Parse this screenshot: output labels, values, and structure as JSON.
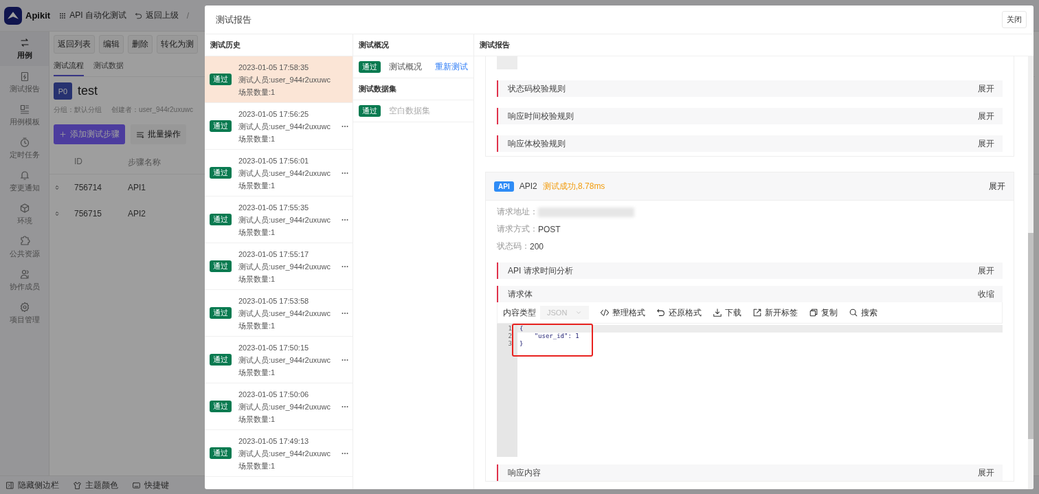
{
  "app": {
    "logo": "Apikit",
    "project": "API 自动化测试",
    "back": "返回上级",
    "separator": "/"
  },
  "sidebar": {
    "items": [
      {
        "label": "用例",
        "selected": true
      },
      {
        "label": "测试报告",
        "selected": false
      },
      {
        "label": "用例模板",
        "selected": false
      },
      {
        "label": "定时任务",
        "selected": false
      },
      {
        "label": "变更通知",
        "selected": false
      },
      {
        "label": "环境",
        "selected": false
      },
      {
        "label": "公共资源",
        "selected": false
      },
      {
        "label": "协作成员",
        "selected": false
      },
      {
        "label": "项目管理",
        "selected": false
      }
    ]
  },
  "toolbar": {
    "buttons": [
      "返回列表",
      "编辑",
      "删除",
      "转化为测"
    ]
  },
  "tabs": [
    {
      "label": "测试流程",
      "selected": true
    },
    {
      "label": "测试数据",
      "selected": false
    }
  ],
  "case": {
    "avatar": "P0",
    "name": "test",
    "group": "分组：默认分组",
    "creator": "创建者：user_944r2uxuwc"
  },
  "actions": {
    "add": "添加测试步骤",
    "batch": "批量操作"
  },
  "table": {
    "columns": [
      "ID",
      "步骤名称"
    ],
    "rows": [
      {
        "id": "756714",
        "name": "API1"
      },
      {
        "id": "756715",
        "name": "API2"
      }
    ]
  },
  "bottom_bar": [
    "隐藏侧边栏",
    "主题颜色",
    "快捷键"
  ],
  "modal": {
    "title": "测试报告",
    "close": "关闭",
    "history": {
      "title": "测试历史",
      "items": [
        {
          "status": "通过",
          "time": "2023-01-05 17:58:35",
          "tester": "测试人员:user_944r2uxuwc",
          "scenes": "场景数量:1",
          "selected": true
        },
        {
          "status": "通过",
          "time": "2023-01-05 17:56:25",
          "tester": "测试人员:user_944r2uxuwc",
          "scenes": "场景数量:1",
          "selected": false
        },
        {
          "status": "通过",
          "time": "2023-01-05 17:56:01",
          "tester": "测试人员:user_944r2uxuwc",
          "scenes": "场景数量:1",
          "selected": false
        },
        {
          "status": "通过",
          "time": "2023-01-05 17:55:35",
          "tester": "测试人员:user_944r2uxuwc",
          "scenes": "场景数量:1",
          "selected": false
        },
        {
          "status": "通过",
          "time": "2023-01-05 17:55:17",
          "tester": "测试人员:user_944r2uxuwc",
          "scenes": "场景数量:1",
          "selected": false
        },
        {
          "status": "通过",
          "time": "2023-01-05 17:53:58",
          "tester": "测试人员:user_944r2uxuwc",
          "scenes": "场景数量:1",
          "selected": false
        },
        {
          "status": "通过",
          "time": "2023-01-05 17:50:15",
          "tester": "测试人员:user_944r2uxuwc",
          "scenes": "场景数量:1",
          "selected": false
        },
        {
          "status": "通过",
          "time": "2023-01-05 17:50:06",
          "tester": "测试人员:user_944r2uxuwc",
          "scenes": "场景数量:1",
          "selected": false
        },
        {
          "status": "通过",
          "time": "2023-01-05 17:49:13",
          "tester": "测试人员:user_944r2uxuwc",
          "scenes": "场景数量:1",
          "selected": false
        }
      ]
    },
    "overview": {
      "title": "测试概况",
      "summary": {
        "status": "通过",
        "label": "测试概况",
        "action": "重新测试"
      },
      "dataset_title": "测试数据集",
      "datasets": [
        {
          "status": "通过",
          "label": "空白数据集"
        }
      ]
    },
    "report": {
      "title": "测试报告",
      "rules": [
        {
          "label": "状态码校验规则",
          "toggle": "展开"
        },
        {
          "label": "响应时间校验规则",
          "toggle": "展开"
        },
        {
          "label": "响应体校验规则",
          "toggle": "展开"
        }
      ],
      "api": {
        "badge": "API",
        "name": "API2",
        "result": "测试成功,8.78ms",
        "toggle": "展开",
        "fields": [
          {
            "kind": "blurred",
            "label": "请求地址："
          },
          {
            "kind": "text",
            "label": "请求方式：",
            "value": "POST"
          },
          {
            "kind": "text",
            "label": "状态码：",
            "value": "200"
          }
        ],
        "sections": [
          {
            "label": "API 请求时间分析",
            "toggle": "展开"
          },
          {
            "label": "请求体",
            "toggle": "收缩",
            "editor": {
              "content_type_label": "内容类型",
              "content_type": "JSON",
              "annotated": true,
              "tools": [
                {
                  "kind": "format",
                  "label": "整理格式"
                },
                {
                  "kind": "restore",
                  "label": "还原格式"
                },
                {
                  "kind": "download",
                  "label": "下载"
                },
                {
                  "kind": "open",
                  "label": "新开标签"
                },
                {
                  "kind": "copy",
                  "label": "复制"
                },
                {
                  "kind": "search",
                  "label": "搜索"
                }
              ],
              "lines": [
                {
                  "number": "1",
                  "text": "{"
                },
                {
                  "number": "2",
                  "text": "    \"user_id\": 1"
                },
                {
                  "number": "3",
                  "text": "}"
                }
              ]
            }
          },
          {
            "label": "响应内容",
            "toggle": "展开"
          }
        ]
      }
    }
  }
}
